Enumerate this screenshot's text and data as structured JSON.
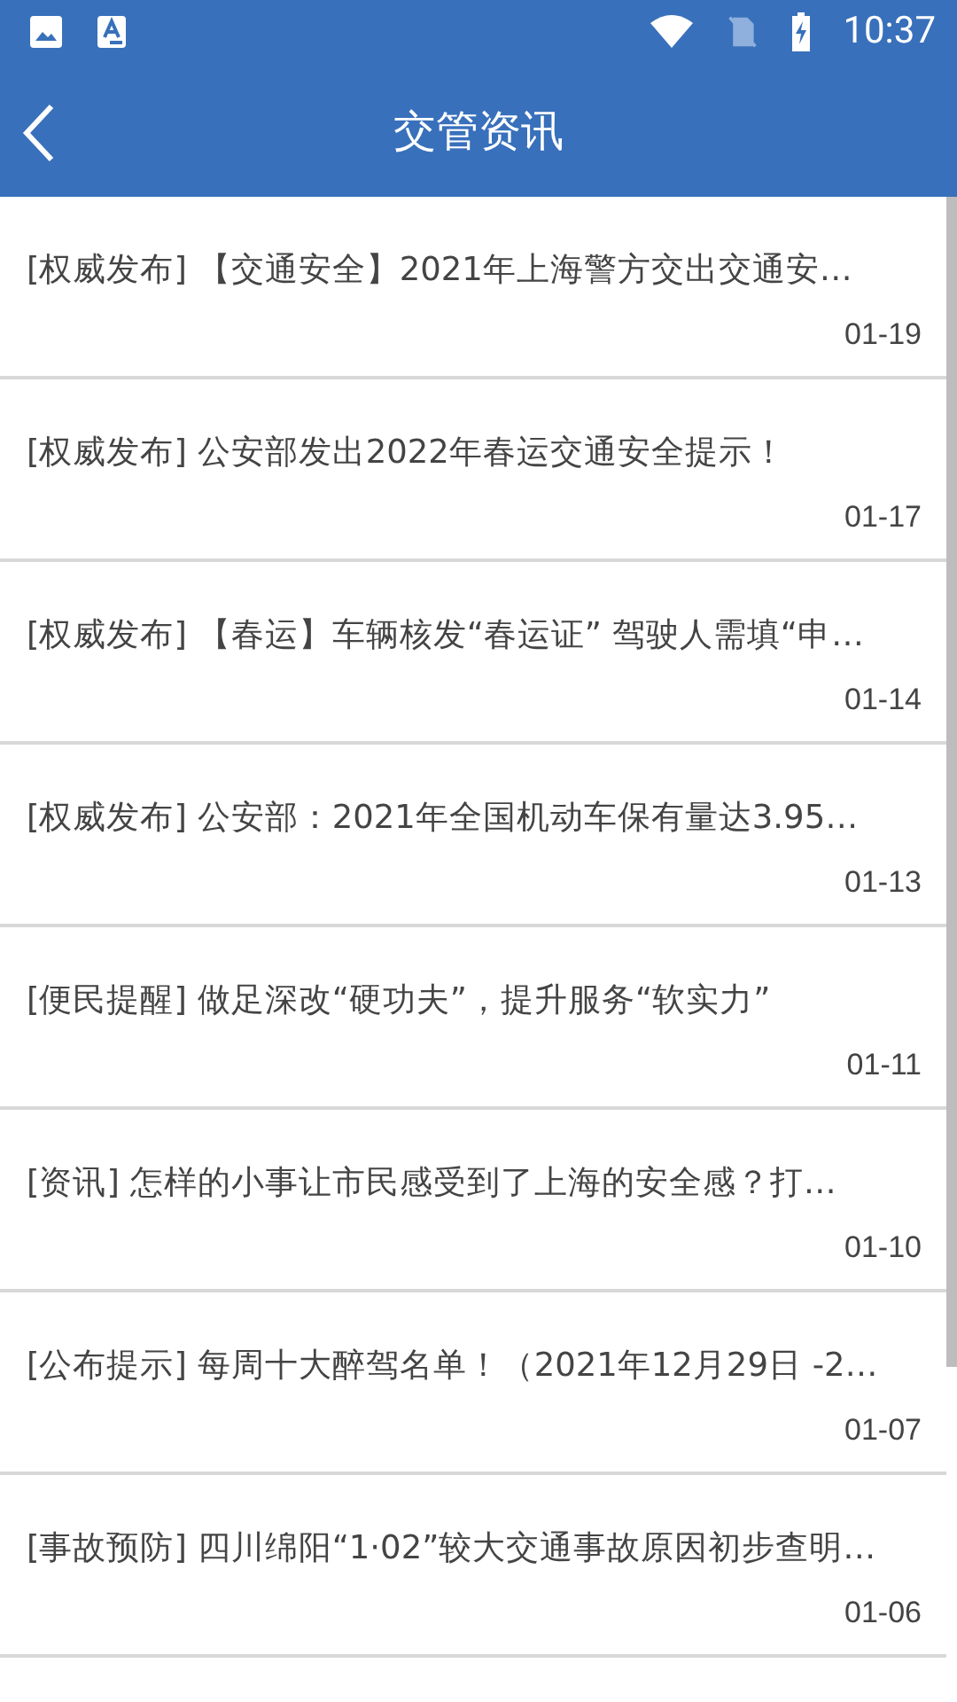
{
  "status_bar": {
    "time": "10:37"
  },
  "toolbar": {
    "title": "交管资讯"
  },
  "news": [
    {
      "title": "[权威发布] 【交通安全】2021年上海警方交出交通安…",
      "date": "01-19"
    },
    {
      "title": "[权威发布] 公安部发出2022年春运交通安全提示！",
      "date": "01-17"
    },
    {
      "title": "[权威发布] 【春运】车辆核发“春运证” 驾驶人需填“申…",
      "date": "01-14"
    },
    {
      "title": "[权威发布] 公安部：2021年全国机动车保有量达3.95…",
      "date": "01-13"
    },
    {
      "title": "[便民提醒] 做足深改“硬功夫”，提升服务“软实力”",
      "date": "01-11"
    },
    {
      "title": "[资讯] 怎样的小事让市民感受到了上海的安全感？打…",
      "date": "01-10"
    },
    {
      "title": "[公布提示] 每周十大醉驾名单！（2021年12月29日 -2…",
      "date": "01-07"
    },
    {
      "title": "[事故预防] 四川绵阳“1·02”较大交通事故原因初步查明…",
      "date": "01-06"
    }
  ]
}
